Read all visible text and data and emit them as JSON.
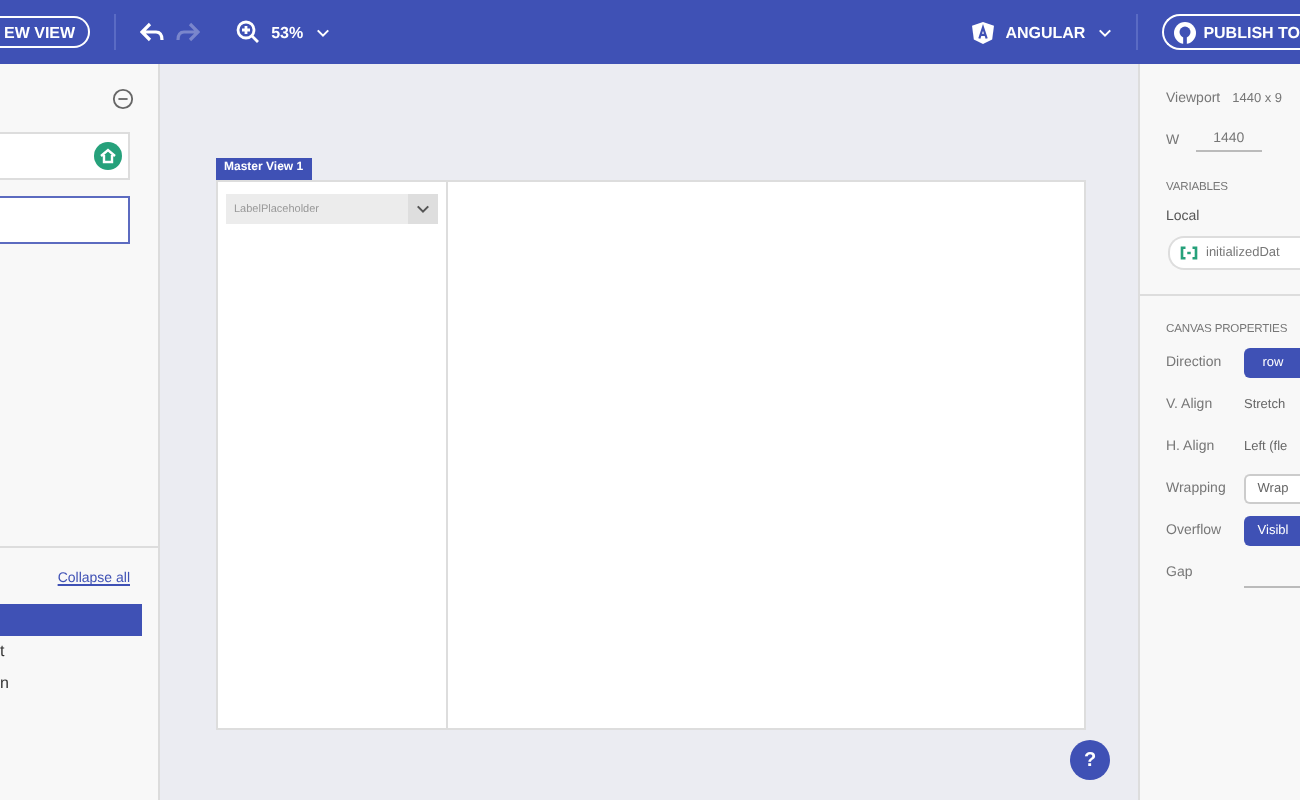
{
  "toolbar": {
    "new_view_button": "EW VIEW",
    "undo_disabled": false,
    "redo_disabled": true,
    "zoom": "53%",
    "framework": "ANGULAR",
    "publish_button": "PUBLISH TO"
  },
  "left_panel": {
    "collapse_link": "Collapse all",
    "items": [
      {
        "selected": true
      },
      {
        "label": "t",
        "selected": false
      },
      {
        "label": "n",
        "selected": false
      }
    ]
  },
  "canvas": {
    "view_tab": "Master View 1",
    "dropdown_placeholder": "LabelPlaceholder"
  },
  "right_panel": {
    "viewport_label": "Viewport",
    "viewport_value": "1440 x 9",
    "width_label": "W",
    "width_value": "1440",
    "variables_heading": "VARIABLES",
    "local_label": "Local",
    "variable_name": "initializedDat",
    "canvas_heading": "CANVAS PROPERTIES",
    "properties": [
      {
        "label": "Direction",
        "value": "row",
        "kind": "button",
        "selected": true
      },
      {
        "label": "V. Align",
        "value": "Stretch",
        "kind": "text"
      },
      {
        "label": "H. Align",
        "value": "Left (fle",
        "kind": "text"
      },
      {
        "label": "Wrapping",
        "value": "Wrap",
        "kind": "button",
        "selected": false
      },
      {
        "label": "Overflow",
        "value": "Visibl",
        "kind": "button",
        "selected": true
      },
      {
        "label": "Gap",
        "kind": "input"
      }
    ]
  },
  "help_button": "?"
}
